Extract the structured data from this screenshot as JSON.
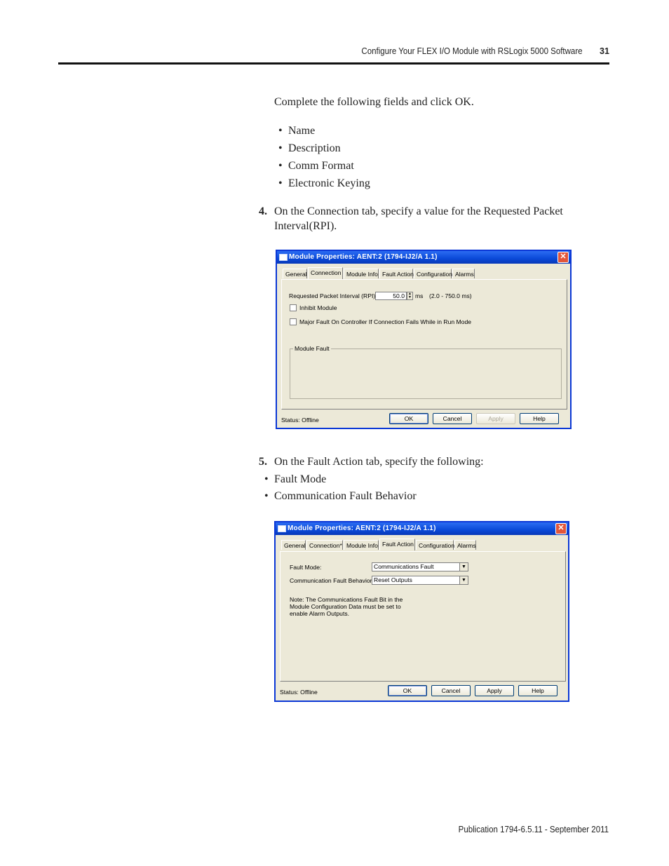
{
  "header": {
    "title": "Configure Your FLEX I/O Module with RSLogix 5000 Software",
    "page_number": "31"
  },
  "intro": "Complete the following fields and click OK.",
  "fields": [
    "Name",
    "Description",
    "Comm Format",
    "Electronic Keying"
  ],
  "step4": {
    "number": "4.",
    "text_line1": "On the Connection tab, specify a value for the Requested Packet",
    "text_line2": "Interval(RPI)."
  },
  "dialog1": {
    "title": "Module Properties: AENT:2 (1794-IJ2/A 1.1)",
    "close": "✕",
    "tabs": [
      "General",
      "Connection",
      "Module Info",
      "Fault Action",
      "Configuration",
      "Alarms"
    ],
    "rpi_label": "Requested Packet Interval (RPI):",
    "rpi_value": "50.0",
    "rpi_unit": "ms",
    "rpi_range": "(2.0 - 750.0 ms)",
    "inhibit_label": "Inhibit Module",
    "major_fault_label": "Major Fault On Controller If Connection Fails While in Run Mode",
    "module_fault_label": "Module Fault",
    "status": "Status:  Offline",
    "buttons": {
      "ok": "OK",
      "cancel": "Cancel",
      "apply": "Apply",
      "help": "Help"
    }
  },
  "step5": {
    "number": "5.",
    "text": "On the Fault Action tab, specify the following:"
  },
  "fault_items": [
    "Fault Mode",
    "Communication Fault Behavior"
  ],
  "dialog2": {
    "title": "Module Properties: AENT:2 (1794-IJ2/A 1.1)",
    "close": "✕",
    "tabs": [
      "General",
      "Connection*",
      "Module Info",
      "Fault Action",
      "Configuration",
      "Alarms"
    ],
    "fault_mode_label": "Fault Mode:",
    "fault_mode_value": "Communications Fault",
    "comm_fault_label": "Communication Fault Behavior:",
    "comm_fault_value": "Reset Outputs",
    "note_line1": "Note: The Communications Fault Bit in the",
    "note_line2": "Module Configuration Data must be set to",
    "note_line3": "enable Alarm Outputs.",
    "status": "Status:  Offline",
    "buttons": {
      "ok": "OK",
      "cancel": "Cancel",
      "apply": "Apply",
      "help": "Help"
    }
  },
  "footer": "Publication 1794-6.5.11 - September 2011"
}
